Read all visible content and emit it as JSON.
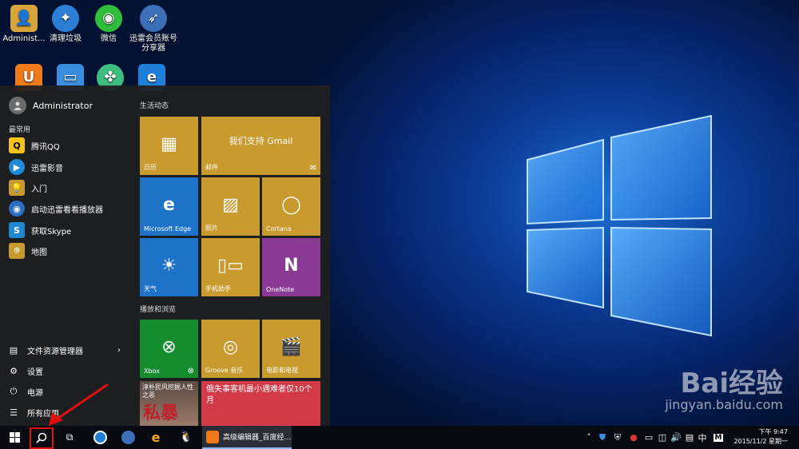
{
  "desktop_icons": [
    {
      "label": "Administ..."
    },
    {
      "label": "清理垃圾"
    },
    {
      "label": "微信"
    },
    {
      "label": "迅雷会员账号分享器"
    }
  ],
  "start_menu": {
    "user_name": "Administrator",
    "most_used_label": "最常用",
    "apps": [
      {
        "label": "腾讯QQ"
      },
      {
        "label": "迅雷影音"
      },
      {
        "label": "入门"
      },
      {
        "label": "启动迅雷看看播放器"
      },
      {
        "label": "获取Skype"
      },
      {
        "label": "地图"
      }
    ],
    "bottom": [
      {
        "label": "文件资源管理器"
      },
      {
        "label": "设置"
      },
      {
        "label": "电源"
      },
      {
        "label": "所有应用"
      }
    ]
  },
  "tiles": {
    "group1_title": "生活动态",
    "group2_title": "播放和浏览",
    "calendar": "日历",
    "mail_headline": "我们支持 Gmail",
    "mail": "邮件",
    "edge": "Microsoft Edge",
    "photos": "照片",
    "cortana": "Cortana",
    "weather": "天气",
    "phone": "手机助手",
    "onenote": "OneNote",
    "xbox": "Xbox",
    "groove": "Groove 音乐",
    "movies": "电影和电视",
    "news_left": "淳朴民风挖掘人性之恶",
    "news_left_big": "私暴",
    "news_right": "俄失事客机最小遇难者仅10个月"
  },
  "taskbar": {
    "active_window": "高级编辑器_百度经...",
    "ime": "中",
    "time": "下午 9:47",
    "date": "2015/11/2 星期一"
  },
  "watermark": {
    "logo": "Bai经验",
    "url": "jingyan.baidu.com"
  }
}
